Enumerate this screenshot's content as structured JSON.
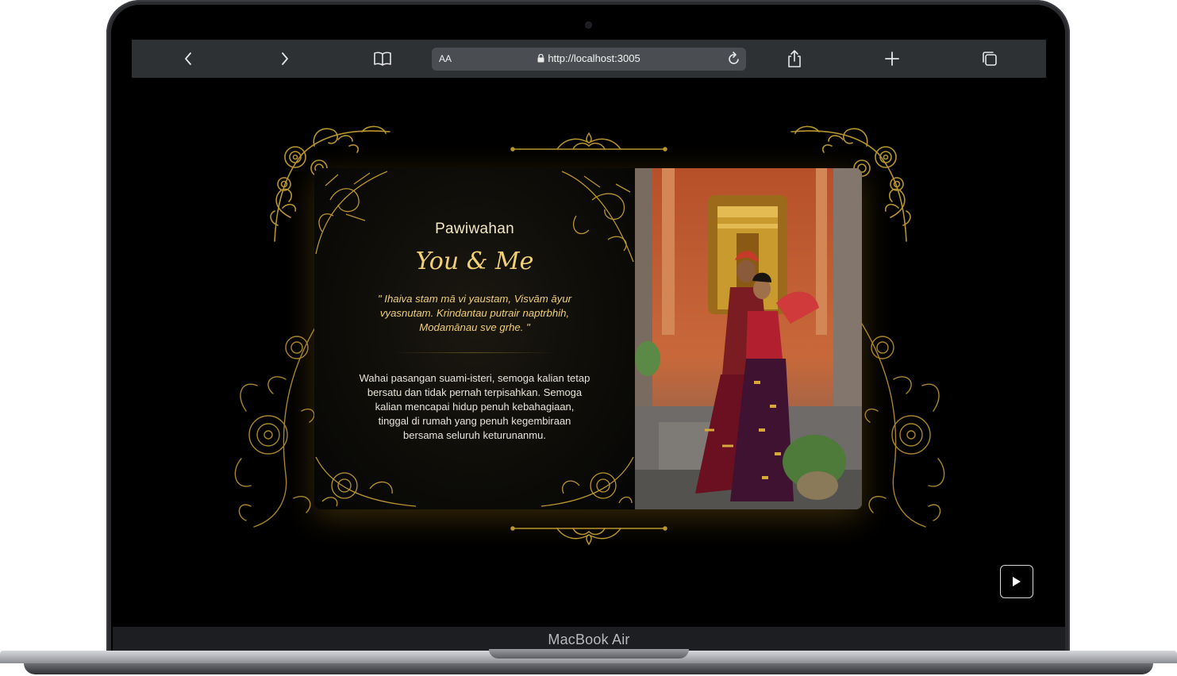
{
  "device": {
    "label": "MacBook Air"
  },
  "browser": {
    "text_size_label": "AA",
    "url": "http://localhost:3005",
    "icons": [
      "back-icon",
      "forward-icon",
      "bookmarks-icon",
      "lock-icon",
      "reload-icon",
      "share-icon",
      "new-tab-icon",
      "tabs-icon"
    ]
  },
  "invitation": {
    "subtitle": "Pawiwahan",
    "title": "You & Me",
    "quote": "\" Ihaiva stam mā vi yaustam, Visvām āyur vyasnutam. Krindantau putrair naptrbhih, Modamānau sve grhe. \"",
    "body": "Wahai pasangan suami-isteri, semoga kalian tetap bersatu dan tidak pernah terpisahkan. Semoga kalian mencapai hidup penuh kebahagiaan, tinggal di rumah yang penuh kegembiraan bersama seluruh keturunanmu.",
    "photo": "couple-in-balinese-attire-photo"
  },
  "player": {
    "icon": "play-icon"
  },
  "colors": {
    "gold": "#f1d073",
    "ornament": "#b8952e",
    "background": "#000000"
  }
}
